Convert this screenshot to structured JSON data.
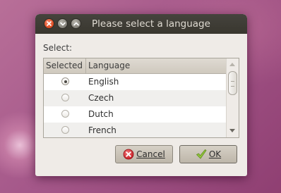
{
  "dialog": {
    "title": "Please select a language",
    "select_label": "Select:",
    "columns": {
      "selected": "Selected",
      "language": "Language"
    },
    "languages": [
      {
        "label": "English",
        "selected": true
      },
      {
        "label": "Czech",
        "selected": false
      },
      {
        "label": "Dutch",
        "selected": false
      },
      {
        "label": "French",
        "selected": false
      }
    ],
    "buttons": {
      "cancel": "Cancel",
      "ok": "OK"
    }
  },
  "icons": {
    "window_close": "close-icon",
    "window_minimize": "chevron-down-icon",
    "window_maximize": "chevron-up-icon",
    "cancel": "cancel-icon",
    "ok": "checkmark-icon"
  },
  "colors": {
    "titlebar": "#3f3d37",
    "close_button": "#df4b20",
    "dialog_background": "#efebe7",
    "ok_check": "#8fc23a",
    "cancel_icon": "#d4262c"
  }
}
